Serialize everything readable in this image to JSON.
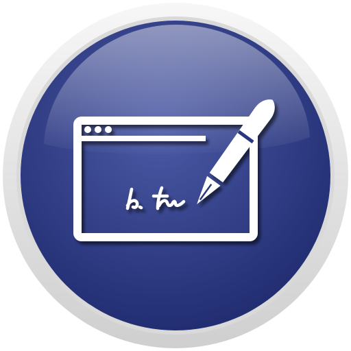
{
  "icon": {
    "name": "e-signature-app-icon",
    "depicts": [
      "browser-window-icon",
      "signature-icon",
      "pen-icon"
    ]
  },
  "colors": {
    "outer_ring": "#e6e6e6",
    "outer_ring_shade": "#cfcfcf",
    "disc_light": "#4b5aa6",
    "disc_dark": "#1f2a6e",
    "glyph": "#ffffff",
    "glyph_shadow": "#151d52"
  }
}
